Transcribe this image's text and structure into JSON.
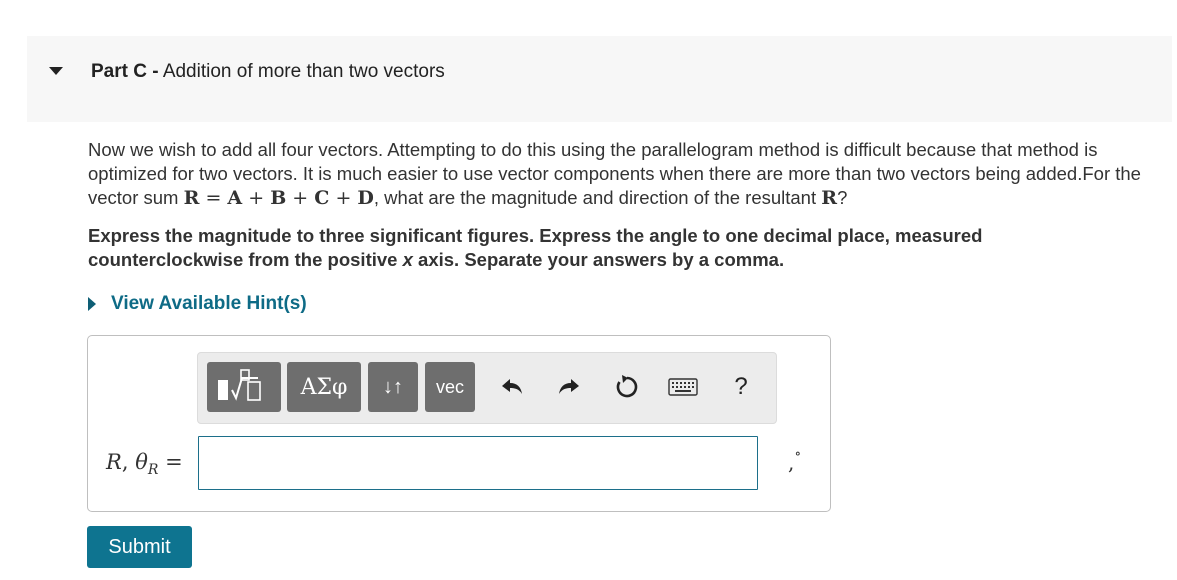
{
  "part": {
    "label": "Part C -",
    "title": "Addition of more than two vectors"
  },
  "problem": {
    "text_1": "Now we wish to add all four vectors. Attempting to do this using the parallelogram method is difficult because that method is optimized for two vectors. It is much easier to use vector components when there are more than two vectors being added.For the vector sum ",
    "sum_lhs": "R",
    "eq": "=",
    "v1": "A",
    "plus": "+",
    "v2": "B",
    "v3": "C",
    "v4": "D",
    "text_2": ", what are the magnitude and direction of the resultant ",
    "resultant": "R",
    "text_3": "?"
  },
  "instructions": {
    "text_1": "Express the magnitude to three significant figures. Express the angle to one decimal place, measured counterclockwise from the positive ",
    "axis": "x",
    "text_2": " axis. Separate your answers by a comma."
  },
  "hint": {
    "label": "View Available Hint(s)"
  },
  "toolbar": {
    "greek_label": "ΑΣφ",
    "arrows_label": "↓↑",
    "vec_label": "vec",
    "help_label": "?",
    "icons": [
      "templates-icon",
      "greek-letters-icon",
      "subscript-superscript-icon",
      "vector-icon",
      "undo-icon",
      "redo-icon",
      "reset-icon",
      "keyboard-icon",
      "help-icon"
    ]
  },
  "answer": {
    "var_r": "R",
    "comma": ",",
    "var_theta": "θ",
    "sub_r": "R",
    "equals": "=",
    "value": "",
    "suffix_comma": ",",
    "suffix_degree": "∘"
  },
  "submit": {
    "label": "Submit"
  },
  "colors": {
    "accent": "#0e7490",
    "link": "#0e6b86",
    "header_bg": "#f7f7f7",
    "toolbar_btn": "#6e6e6e"
  }
}
